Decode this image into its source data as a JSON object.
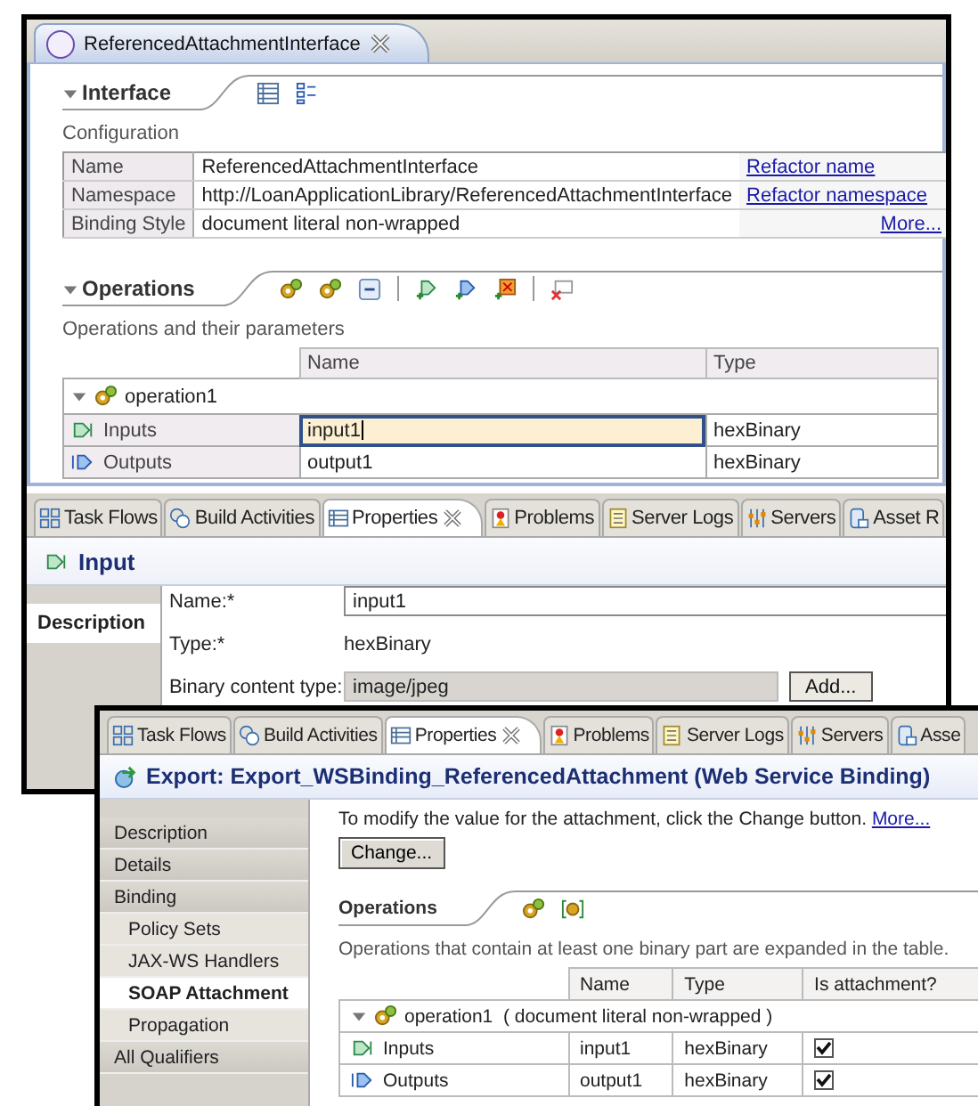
{
  "editor": {
    "tab": "ReferencedAttachmentInterface",
    "interface": {
      "title": "Interface",
      "expanded": true,
      "subtitle": "Configuration",
      "rows": [
        {
          "label": "Name",
          "value": "ReferencedAttachmentInterface",
          "link": "Refactor name"
        },
        {
          "label": "Namespace",
          "value": "http://LoanApplicationLibrary/ReferencedAttachmentInterface",
          "link": "Refactor namespace"
        },
        {
          "label": "Binding Style",
          "value": "document literal non-wrapped",
          "more_link": "More..."
        }
      ]
    },
    "operations": {
      "title": "Operations",
      "expanded": true,
      "subtitle": "Operations and their parameters",
      "columns": [
        "Name",
        "Type"
      ],
      "tree": [
        {
          "label": "operation1",
          "expanded": true,
          "children": [
            {
              "kind": "input",
              "label": "Inputs",
              "name": "input1",
              "type": "hexBinary",
              "editing": true
            },
            {
              "kind": "output",
              "label": "Outputs",
              "name": "output1",
              "type": "hexBinary",
              "editing": false
            }
          ]
        }
      ]
    }
  },
  "view_tabs": [
    {
      "label": "Task Flows",
      "kind": "flows",
      "selected": false
    },
    {
      "label": "Build Activities",
      "kind": "activities",
      "selected": false
    },
    {
      "label": "Properties",
      "kind": "properties",
      "selected": true
    },
    {
      "label": "Problems",
      "kind": "problems",
      "selected": false
    },
    {
      "label": "Server Logs",
      "kind": "logs",
      "selected": false
    },
    {
      "label": "Servers",
      "kind": "servers",
      "selected": false
    },
    {
      "label": "Asset R",
      "kind": "assets",
      "selected": false
    }
  ],
  "properties": {
    "title": "Input",
    "side_tabs": [
      {
        "label": "Description",
        "selected": true
      }
    ],
    "fields": [
      {
        "label": "Name:*",
        "kind": "text",
        "value": "input1"
      },
      {
        "label": "Type:*",
        "kind": "static",
        "value": "hexBinary"
      },
      {
        "label": "Binary content type:",
        "kind": "readonly",
        "value": "image/jpeg",
        "button": "Add..."
      }
    ]
  },
  "export_window": {
    "view_tabs": [
      {
        "label": "Task Flows",
        "kind": "flows",
        "selected": false
      },
      {
        "label": "Build Activities",
        "kind": "activities",
        "selected": false
      },
      {
        "label": "Properties",
        "kind": "properties",
        "selected": true
      },
      {
        "label": "Problems",
        "kind": "problems",
        "selected": false
      },
      {
        "label": "Server Logs",
        "kind": "logs",
        "selected": false
      },
      {
        "label": "Servers",
        "kind": "servers",
        "selected": false
      },
      {
        "label": "Asse",
        "kind": "assets",
        "selected": false
      }
    ],
    "title": "Export: Export_WSBinding_ReferencedAttachment (Web Service Binding)",
    "nav": [
      {
        "label": "Description",
        "selected": false
      },
      {
        "label": "Details",
        "selected": false
      },
      {
        "label": "Binding",
        "selected": false,
        "children": [
          {
            "label": "Policy Sets",
            "selected": false
          },
          {
            "label": "JAX-WS Handlers",
            "selected": false
          },
          {
            "label": "SOAP Attachment",
            "selected": true
          },
          {
            "label": "Propagation",
            "selected": false
          }
        ]
      },
      {
        "label": "All Qualifiers",
        "selected": false
      }
    ],
    "intro": "To modify the value for the attachment, click the Change button.",
    "intro_link": "More...",
    "button": "Change...",
    "operations": {
      "title": "Operations",
      "description": "Operations that contain at least one binary part are expanded in the table.",
      "columns": [
        "Name",
        "Type",
        "Is attachment?"
      ],
      "tree": [
        {
          "label": "operation1",
          "detail": "( document literal non-wrapped )",
          "expanded": true,
          "children": [
            {
              "kind": "input",
              "label": "Inputs",
              "name": "input1",
              "type": "hexBinary",
              "attachment": true
            },
            {
              "kind": "output",
              "label": "Outputs",
              "name": "output1",
              "type": "hexBinary",
              "attachment": true
            }
          ]
        }
      ]
    }
  }
}
